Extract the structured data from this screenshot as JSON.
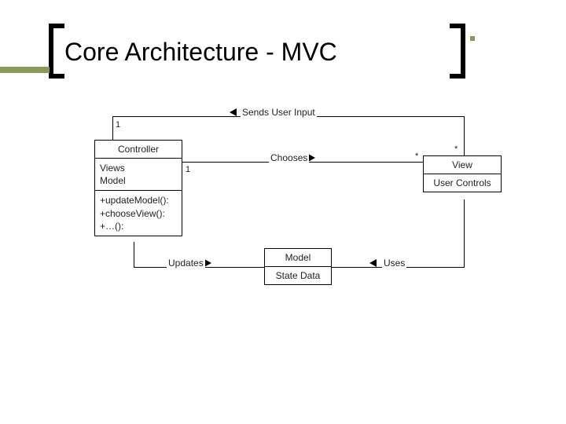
{
  "title": "Core Architecture - MVC",
  "boxes": {
    "controller": {
      "name": "Controller",
      "attrs": "Views\nModel",
      "ops": "+updateModel():\n+chooseView():\n+…():"
    },
    "view": {
      "name": "View",
      "attrs": "User Controls"
    },
    "model": {
      "name": "Model",
      "attrs": "State Data"
    }
  },
  "labels": {
    "sendsUserInput": "Sends User Input",
    "chooses": "Chooses",
    "updates": "Updates",
    "uses": "Uses"
  },
  "mult": {
    "ctrl_top": "1",
    "view_top": "*",
    "ctrl_mid": "1",
    "view_mid": "*"
  }
}
